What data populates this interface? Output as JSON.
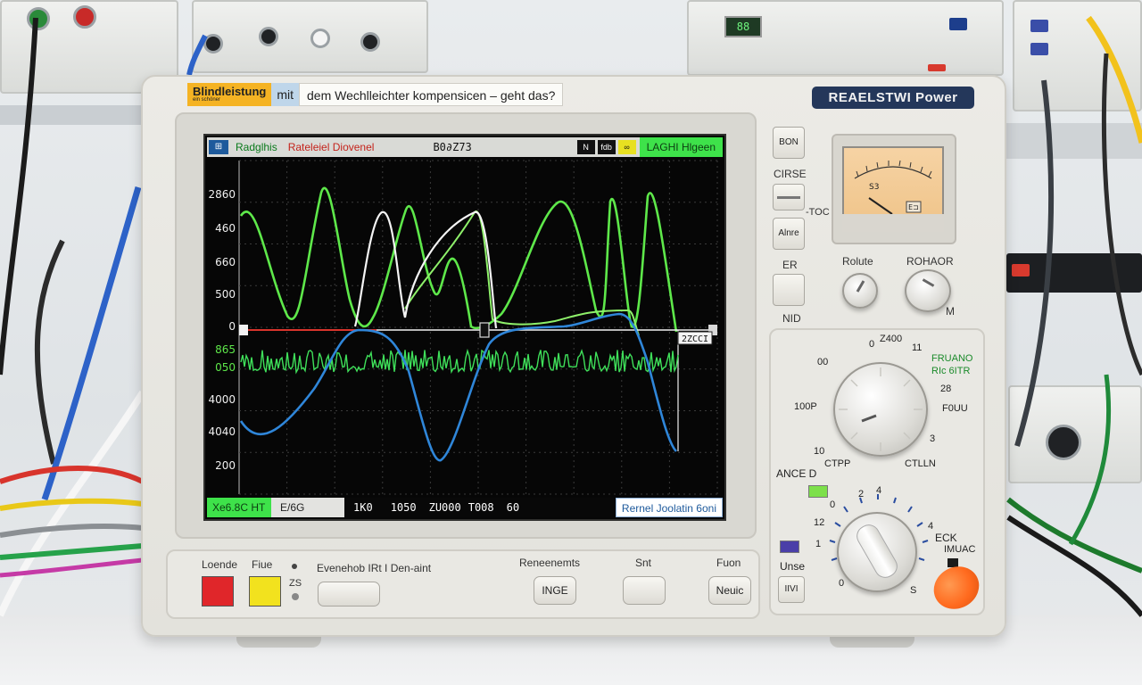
{
  "background": {
    "lcd_reading": "88"
  },
  "title_bar": {
    "chip1": "Blindleistung",
    "chip1_small": "ein schöner",
    "chip2": "mit",
    "question": "dem Wechlleichter kompensicen – geht das?"
  },
  "brand": "REAELSTWI Power",
  "screen": {
    "top": {
      "icon": "⊞",
      "mode": "Radglhis",
      "channel": "Rateleiel Diovenel",
      "time": "B0∂Z73",
      "box1": "N",
      "box2": "fdb",
      "box3": "∞",
      "trigger": "LAGHI Hlgeen"
    },
    "y_ticks": [
      "2860",
      "460",
      "660",
      "500",
      "0",
      "865",
      "050",
      "4000",
      "4040",
      "200"
    ],
    "marker_label": "2ZCCI",
    "bottom": {
      "green_label": "Xe6.8C HT",
      "grey_label": "E/6G",
      "values": [
        "1K0",
        "1050",
        "ZU000",
        "T008",
        "60"
      ],
      "right_label": "Rernel Joolatin 6oni"
    }
  },
  "side_buttons": {
    "b1": "BON",
    "label_after_b1": "CIRSE",
    "label_b2_right": "-TOC",
    "b3": "Alnre",
    "label_er": "ER",
    "label_nid": "NID"
  },
  "meter": {
    "scale_text": "S3",
    "unit_box": "E⊐"
  },
  "knobs": {
    "left_label": "Rolute",
    "right_label": "ROHAOR",
    "m_label": "M"
  },
  "dial_panel": {
    "top_numbers": [
      "0",
      "Z400",
      "11"
    ],
    "side_label_1": "FRUANO",
    "side_label_2": "RIc 6ITR",
    "left_numbers": [
      "00",
      "100P",
      "10"
    ],
    "right_numbers": [
      "28",
      "F0UU",
      "3"
    ],
    "bottom_label_left": "CTPP",
    "bottom_label_right": "CTLLN",
    "ance_label": "ANCE D",
    "lower_numbers": [
      "0",
      "2",
      "4",
      "12",
      "1",
      "0",
      "4",
      "S"
    ],
    "eck_label": "ECK",
    "imuac_label": "IMUAC",
    "unse_label": "Unse",
    "btn_label": "IIVI"
  },
  "bottom_panel": {
    "lbl_loende": "Loende",
    "lbl_fiue": "Fiue",
    "lbl_zs": "ZS",
    "lbl_desc": "Evenehob IRt I Den-aint",
    "lbl_reneements": "Reneenemts",
    "lbl_snt": "Snt",
    "lbl_fuon": "Fuon",
    "btn_inge": "INGE",
    "btn_neuc": "Neuic"
  },
  "colors": {
    "trace_green": "#5ee84a",
    "trace_white": "#f4f4f4",
    "trace_blue": "#2f86d9",
    "noise_green": "#3fe05a",
    "red_button": "#e0262a",
    "yellow_button": "#f2e21e",
    "orange_knob": "#ff6a1e"
  }
}
